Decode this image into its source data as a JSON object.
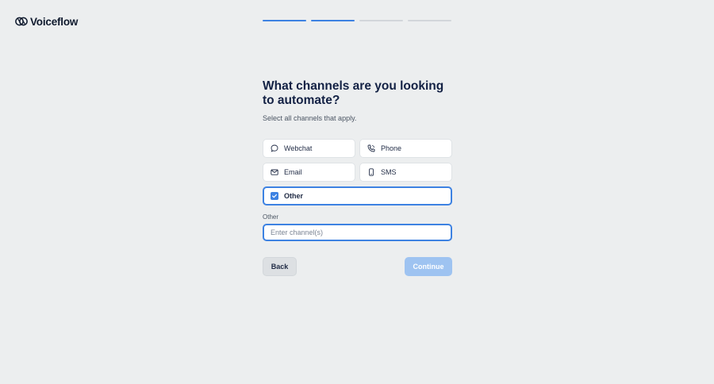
{
  "brand": {
    "name": "Voiceflow",
    "accent": "#3d82e2"
  },
  "progress": {
    "steps_total": 4,
    "steps_done": 2
  },
  "page": {
    "title": "What channels are you looking to automate?",
    "subtitle": "Select all channels that apply."
  },
  "options": [
    {
      "label": "Webchat",
      "icon": "chat-bubble-icon",
      "selected": false
    },
    {
      "label": "Phone",
      "icon": "phone-icon",
      "selected": false
    },
    {
      "label": "Email",
      "icon": "envelope-icon",
      "selected": false
    },
    {
      "label": "SMS",
      "icon": "mobile-icon",
      "selected": false
    },
    {
      "label": "Other",
      "icon": "checkbox-checked-icon",
      "selected": true
    }
  ],
  "other_field": {
    "label": "Other",
    "placeholder": "Enter channel(s)",
    "value": ""
  },
  "actions": {
    "back_label": "Back",
    "continue_label": "Continue"
  }
}
